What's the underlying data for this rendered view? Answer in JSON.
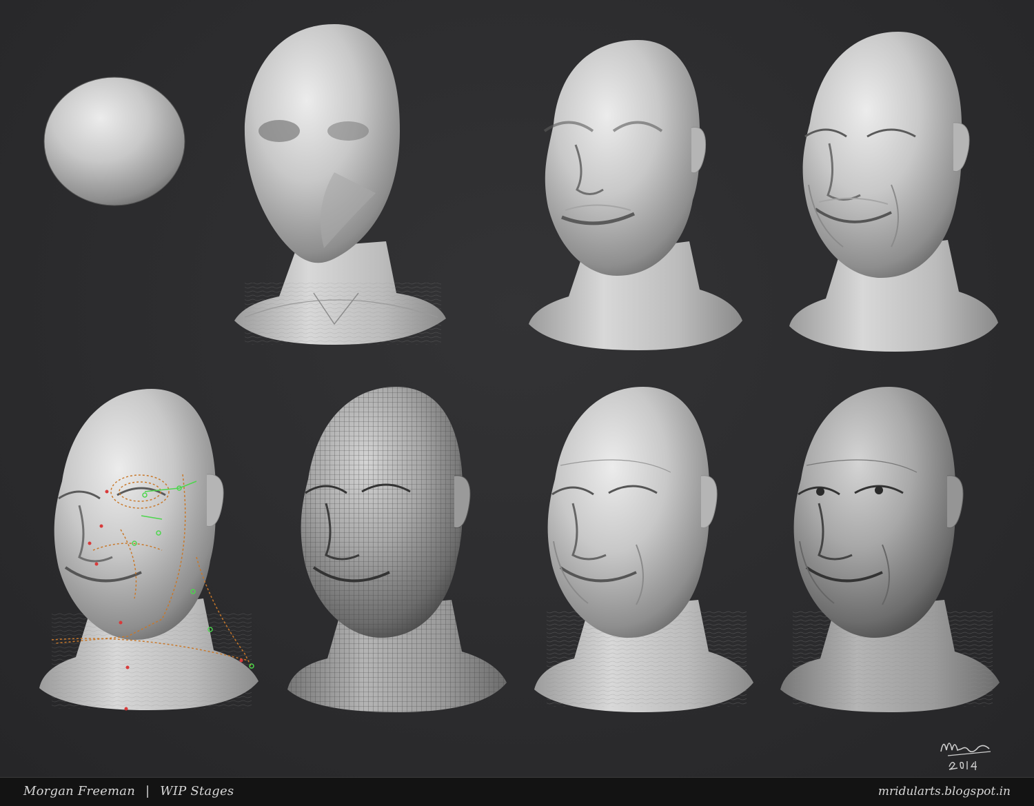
{
  "footer": {
    "subject": "Morgan Freeman",
    "separator": "|",
    "label": "WIP Stages",
    "website": "mridularts.blogspot.in"
  },
  "signature": {
    "text": "Mrid",
    "year": "2014"
  },
  "stages": [
    {
      "id": 1,
      "form": "sphere",
      "shade": "#b9b9b9"
    },
    {
      "id": 2,
      "form": "blockout-head",
      "shade": "#c4c4c4"
    },
    {
      "id": 3,
      "form": "primary-forms",
      "shade": "#c6c6c6"
    },
    {
      "id": 4,
      "form": "secondary-forms",
      "shade": "#c8c8c8"
    },
    {
      "id": 5,
      "form": "topology-guides",
      "shade": "#c8c8c8"
    },
    {
      "id": 6,
      "form": "retopology-wireframe",
      "shade": "#a8a8a8"
    },
    {
      "id": 7,
      "form": "detailed-sculpt",
      "shade": "#c2c2c2"
    },
    {
      "id": 8,
      "form": "final-sculpt",
      "shade": "#a9a9a9"
    }
  ],
  "colors": {
    "background": "#2c2c2e",
    "footer": "#131313",
    "footer_text": "#d6d6d6",
    "clay": "#c6c6c6",
    "guide_green": "#4cd64c",
    "guide_red": "#d83a3a",
    "guide_orange": "#c8782a"
  }
}
